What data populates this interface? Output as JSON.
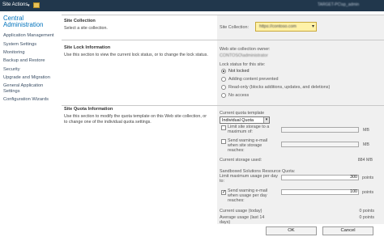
{
  "topbar": {
    "site_actions": "Site Actions",
    "user": "TARGET-PC\\sp_admin"
  },
  "nav": {
    "heading": "Central Administration",
    "items": [
      "Application Management",
      "System Settings",
      "Monitoring",
      "Backup and Restore",
      "Security",
      "Upgrade and Migration",
      "General Application Settings",
      "Configuration Wizards"
    ]
  },
  "site_collection": {
    "title": "Site Collection",
    "desc": "Select a site collection.",
    "field_label": "Site Collection:",
    "value": "https://contoso.com"
  },
  "site_lock": {
    "title": "Site Lock Information",
    "desc": "Use this section to view the current lock status, or to change the lock status.",
    "owner_label": "Web site collection owner:",
    "owner_value": "CONTOSO\\administrator",
    "status_label": "Lock status for this site:",
    "options": [
      "Not locked",
      "Adding content prevented",
      "Read-only (blocks additions, updates, and deletions)",
      "No access"
    ]
  },
  "quota": {
    "title": "Site Quota Information",
    "desc": "Use this section to modify the quota template on this Web site collection, or to change one of the individual quota settings.",
    "template_label": "Current quota template",
    "template_value": "Individual Quota",
    "limit_label": "Limit site storage to a maximum of:",
    "limit_unit": "MB",
    "warn_label": "Send warning e-mail when site storage reaches:",
    "warn_unit": "MB",
    "current_label": "Current storage used:",
    "current_value": "884 MB",
    "sandbox_label": "Sandboxed Solutions Resource Quota:",
    "sandbox_limit_label": "Limit maximum usage per day to:",
    "sandbox_limit_value": "300",
    "sandbox_limit_unit": "points",
    "sandbox_warn_label": "Send warning e-mail when usage per day reaches:",
    "sandbox_warn_value": "100",
    "sandbox_warn_unit": "points",
    "usage_today_label": "Current usage (today)",
    "usage_today_value": "0 points",
    "usage_avg_label": "Average usage (last 14 days)",
    "usage_avg_value": "0 points"
  },
  "buttons": {
    "ok": "OK",
    "cancel": "Cancel"
  },
  "colors": {
    "topbar": "#21374c",
    "nav_heading": "#0072bc",
    "picker_highlight": "#fff2a8",
    "panel": "#f0f0f0"
  }
}
